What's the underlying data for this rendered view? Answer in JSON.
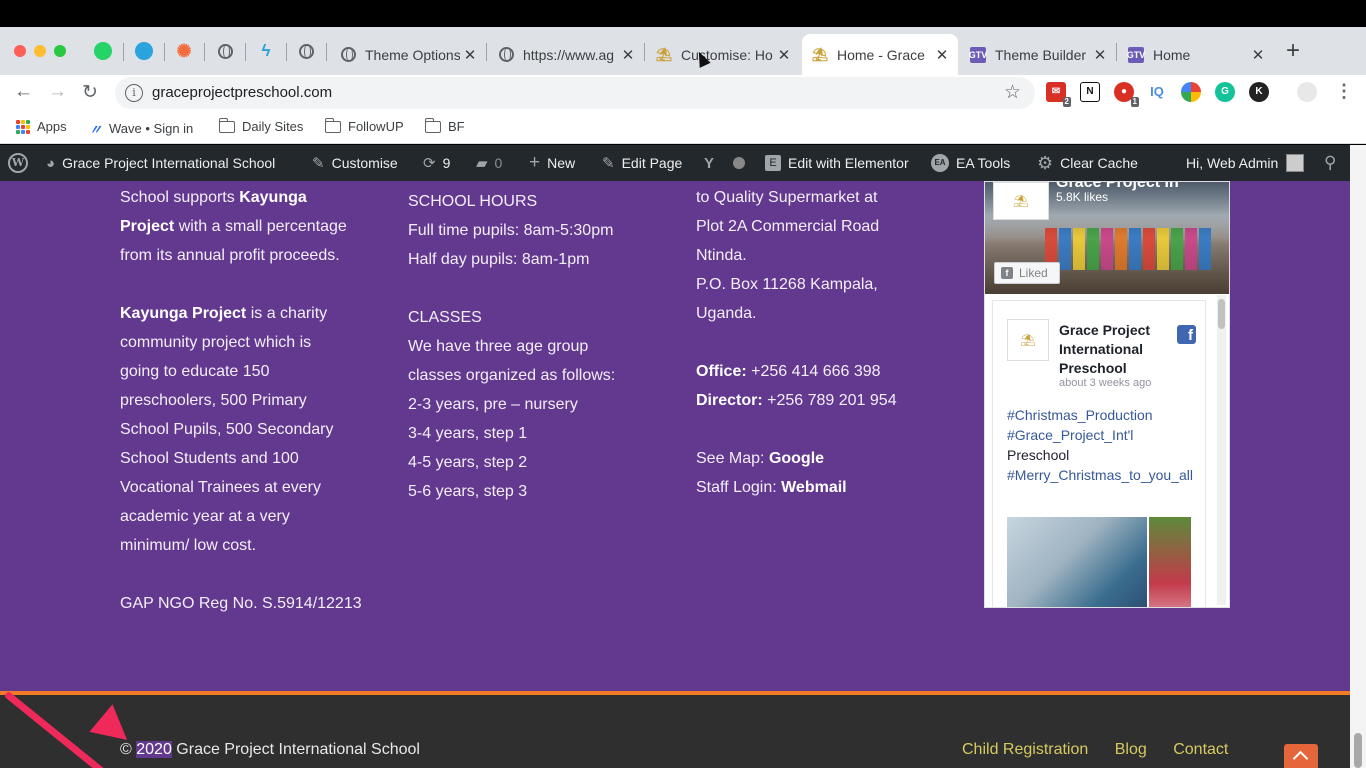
{
  "browser": {
    "tabs": [
      {
        "title": "Theme Options",
        "active": false
      },
      {
        "title": "https://www.ag",
        "active": false
      },
      {
        "title": "Customise: Ho",
        "active": false
      },
      {
        "title": "Home - Grace",
        "active": true
      },
      {
        "title": "Theme Builder",
        "active": false
      },
      {
        "title": "Home",
        "active": false
      }
    ],
    "url": "graceprojectpreschool.com",
    "extension_badges": [
      "2",
      "1"
    ],
    "ext_labels": {
      "n": "N",
      "iq": "IQ",
      "g": "G",
      "k": "K"
    },
    "bookmarks": [
      {
        "label": "Apps",
        "icon": "apps-grid-icon"
      },
      {
        "label": "Wave • Sign in",
        "icon": "wave-icon"
      },
      {
        "label": "Daily Sites",
        "icon": "folder-icon"
      },
      {
        "label": "FollowUP",
        "icon": "folder-icon"
      },
      {
        "label": "BF",
        "icon": "folder-icon"
      }
    ]
  },
  "admin_bar": {
    "site_name": "Grace Project International School",
    "customise": "Customise",
    "updates_count": "9",
    "comments_count": "0",
    "new": "New",
    "edit_page": "Edit Page",
    "edit_elementor": "Edit with Elementor",
    "ea_tools": "EA Tools",
    "clear_cache": "Clear Cache",
    "greeting": "Hi, Web Admin"
  },
  "col1": {
    "l1_pre": "School supports ",
    "l1_bold": "Kayunga",
    "l2_bold": "Project",
    "l2_post": " with a small percentage",
    "l3": "from its annual profit proceeds.",
    "p2_bold": "Kayunga Project",
    "p2_l1_post": " is a charity",
    "p2_lines": [
      "community project which is",
      "going to educate 150",
      "preschoolers, 500 Primary",
      "School Pupils, 500 Secondary",
      "School Students and 100",
      "Vocational Trainees at every",
      "academic year at a very",
      "minimum/ low cost."
    ],
    "reg": "GAP NGO Reg No. S.5914/12213"
  },
  "col2": {
    "hours_heading": "SCHOOL HOURS",
    "hours": [
      "Full time pupils: 8am-5:30pm",
      "Half day pupils: 8am-1pm"
    ],
    "classes_heading": "CLASSES",
    "classes_intro": [
      "We have three age group",
      "classes organized as follows:"
    ],
    "classes": [
      "2-3 years, pre – nursery",
      "3-4 years, step 1",
      "4-5 years, step 2",
      "5-6 years, step 3"
    ]
  },
  "col3": {
    "address": [
      "to Quality Supermarket at",
      "Plot 2A Commercial Road",
      "Ntinda.",
      "P.O. Box 11268 Kampala,",
      "Uganda."
    ],
    "office_label": "Office:",
    "office_number": " +256 414 666 398",
    "director_label": "Director:",
    "director_number": " +256 789 201 954",
    "map_label": "See Map: ",
    "map_link": "Google",
    "login_label": "Staff Login: ",
    "login_link": "Webmail"
  },
  "facebook": {
    "cover_title": "Grace Project In",
    "likes": "5.8K likes",
    "liked_button": "Liked",
    "page_name": "Grace Project International Preschool",
    "post_time": "about 3 weeks ago",
    "post_tag1": "#Christmas_Production",
    "post_tag2": "#Grace_Project_Int'l",
    "post_word": "Preschool",
    "post_tag3": "#Merry_Christmas_to_you_all"
  },
  "footer": {
    "copyright_symbol": "©",
    "copyright_year": "2020",
    "copyright_rest": " Grace Project International School",
    "links": [
      "Child Registration",
      "Blog",
      "Contact"
    ]
  },
  "colors": {
    "content_bg": "#63398f",
    "footer_bg": "#2f2f2f",
    "accent_orange": "#f37b28",
    "link_gold": "#d6c960",
    "annotation_arrow": "#ef2a5b"
  }
}
